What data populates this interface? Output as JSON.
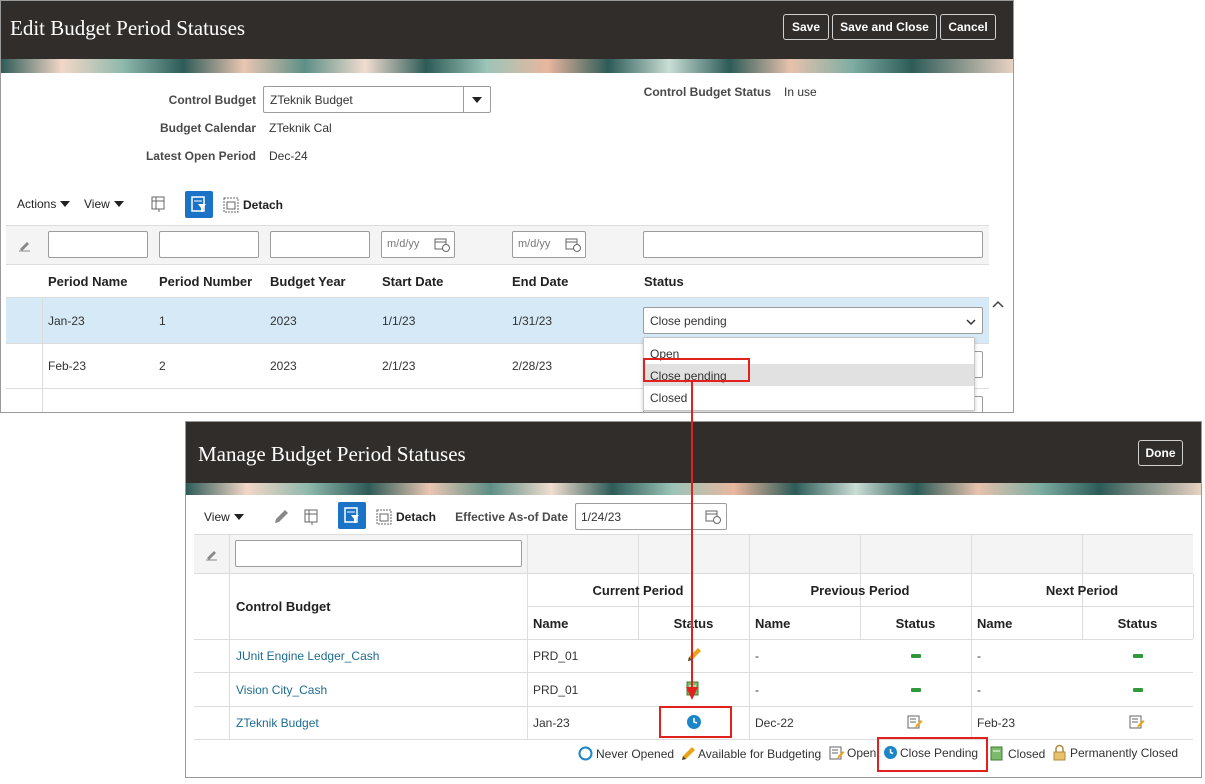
{
  "edit": {
    "title": "Edit Budget Period Statuses",
    "buttons": {
      "save": "Save",
      "save_close": "Save and Close",
      "cancel": "Cancel"
    },
    "control_budget_label": "Control Budget",
    "control_budget_value": "ZTeknik Budget",
    "budget_calendar_label": "Budget Calendar",
    "budget_calendar_value": "ZTeknik Cal",
    "latest_open_label": "Latest Open Period",
    "latest_open_value": "Dec-24",
    "cb_status_label": "Control Budget Status",
    "cb_status_value": "In use",
    "toolbar": {
      "actions": "Actions",
      "view": "View",
      "detach": "Detach"
    },
    "date_placeholder": "m/d/yy",
    "columns": [
      "Period Name",
      "Period Number",
      "Budget Year",
      "Start Date",
      "End Date",
      "Status"
    ],
    "rows": [
      {
        "name": "Jan-23",
        "number": "1",
        "year": "2023",
        "start": "1/1/23",
        "end": "1/31/23",
        "status": "Close pending"
      },
      {
        "name": "Feb-23",
        "number": "2",
        "year": "2023",
        "start": "2/1/23",
        "end": "2/28/23",
        "status": ""
      }
    ],
    "status_options": [
      "Open",
      "Close pending",
      "Closed"
    ]
  },
  "manage": {
    "title": "Manage Budget Period Statuses",
    "done": "Done",
    "toolbar": {
      "view": "View",
      "detach": "Detach",
      "eff_label": "Effective As-of Date",
      "eff_value": "1/24/23"
    },
    "col_control_budget": "Control Budget",
    "groups": [
      "Current Period",
      "Previous Period",
      "Next Period"
    ],
    "sub_name": "Name",
    "sub_status": "Status",
    "rows": [
      {
        "budget": "JUnit Engine Ledger_Cash",
        "cur_name": "PRD_01",
        "prev_name": "-",
        "next_name": "-"
      },
      {
        "budget": "Vision City_Cash",
        "cur_name": "PRD_01",
        "prev_name": "-",
        "next_name": "-"
      },
      {
        "budget": "ZTeknik Budget",
        "cur_name": "Jan-23",
        "prev_name": "Dec-22",
        "next_name": "Feb-23"
      }
    ],
    "legend": {
      "never_opened": "Never Opened",
      "available": "Available for Budgeting",
      "open": "Open",
      "close_pending": "Close Pending",
      "closed": "Closed",
      "perm_closed": "Permanently Closed"
    }
  },
  "colors": {
    "header": "#312d2a",
    "highlight": "#e0211d",
    "link": "#1d6b8f",
    "selected_row": "#d6e9f7"
  }
}
